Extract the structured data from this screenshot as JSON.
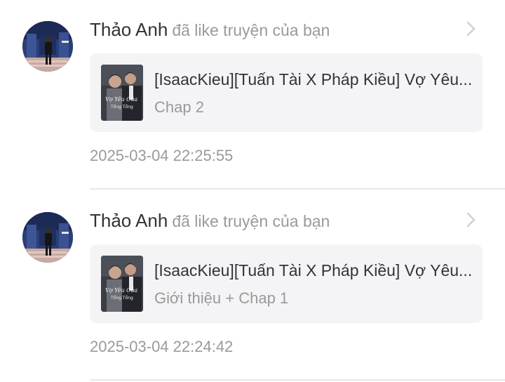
{
  "notifications": [
    {
      "user_name": "Thảo Anh",
      "action": "đã like truyện của bạn",
      "avatar_icon": "user-photo",
      "story_title": "[IsaacKieu][Tuấn Tài X Pháp Kiều] Vợ Yêu...",
      "chapter": "Chap 2",
      "cover_caption": [
        "Vợ Yêu Của",
        "Tổng Tổng"
      ],
      "timestamp": "2025-03-04 22:25:55",
      "chevron_icon": "chevron-right-icon"
    },
    {
      "user_name": "Thảo Anh",
      "action": "đã like truyện của bạn",
      "avatar_icon": "user-photo",
      "story_title": "[IsaacKieu][Tuấn Tài X Pháp Kiều] Vợ Yêu...",
      "chapter": "Giới thiệu + Chap 1",
      "cover_caption": [
        "Vợ Yêu Của",
        "Tổng Tổng"
      ],
      "timestamp": "2025-03-04 22:24:42",
      "chevron_icon": "chevron-right-icon"
    }
  ],
  "colors": {
    "name": "#333333",
    "secondary_text": "#9a9a9a",
    "card_background": "#f4f4f6",
    "divider": "#e8e8e8",
    "chevron": "#d0d0d0"
  }
}
